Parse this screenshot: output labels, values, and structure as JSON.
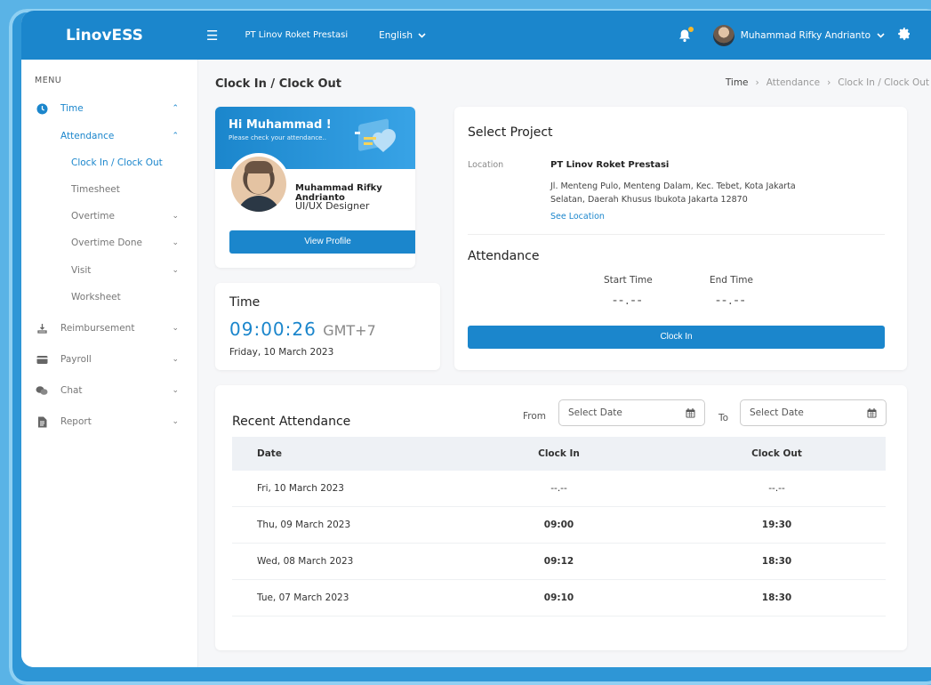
{
  "header": {
    "logo_prefix": "Linov",
    "logo_suffix": "ESS",
    "company": "PT Linov Roket Prestasi",
    "language": "English",
    "user_name": "Muhammad Rifky Andrianto"
  },
  "sidebar": {
    "menu_title": "MENU",
    "items": [
      {
        "label": "Time"
      },
      {
        "label": "Attendance"
      },
      {
        "label": "Clock In / Clock Out"
      },
      {
        "label": "Timesheet"
      },
      {
        "label": "Overtime"
      },
      {
        "label": "Overtime Done"
      },
      {
        "label": "Visit"
      },
      {
        "label": "Worksheet"
      },
      {
        "label": "Reimbursement"
      },
      {
        "label": "Payroll"
      },
      {
        "label": "Chat"
      },
      {
        "label": "Report"
      }
    ]
  },
  "page": {
    "title": "Clock In / Clock Out",
    "breadcrumb": [
      "Time",
      "Attendance",
      "Clock In / Clock Out"
    ]
  },
  "profile": {
    "greeting": "Hi Muhammad !",
    "subtext": "Please check your attendance..",
    "name": "Muhammad Rifky Andrianto",
    "role": "UI/UX Designer",
    "view_profile": "View Profile"
  },
  "time": {
    "label": "Time",
    "clock": "09:00:26",
    "timezone": "GMT+7",
    "date": "Friday, 10 March 2023"
  },
  "project": {
    "title": "Select Project",
    "location_label": "Location",
    "location_name": "PT Linov Roket Prestasi",
    "address": "Jl. Menteng Pulo, Menteng Dalam, Kec. Tebet, Kota Jakarta Selatan, Daerah Khusus Ibukota Jakarta 12870",
    "see_location": "See Location",
    "attendance_title": "Attendance",
    "start_time_label": "Start Time",
    "end_time_label": "End Time",
    "start_time_value": "--.--",
    "end_time_value": "--.--",
    "clock_in_button": "Clock In"
  },
  "recent": {
    "title": "Recent Attendance",
    "from_label": "From",
    "to_label": "To",
    "from_placeholder": "Select Date",
    "to_placeholder": "Select Date",
    "columns": [
      "Date",
      "Clock In",
      "Clock Out"
    ],
    "rows": [
      {
        "date": "Fri, 10 March 2023",
        "clock_in": "--.--",
        "clock_out": "--.--"
      },
      {
        "date": "Thu, 09 March 2023",
        "clock_in": "09:00",
        "clock_out": "19:30"
      },
      {
        "date": "Wed, 08 March 2023",
        "clock_in": "09:12",
        "clock_out": "18:30"
      },
      {
        "date": "Tue, 07 March 2023",
        "clock_in": "09:10",
        "clock_out": "18:30"
      }
    ]
  },
  "colors": {
    "primary": "#1b86cc",
    "accent_dot": "#f6b82b"
  }
}
